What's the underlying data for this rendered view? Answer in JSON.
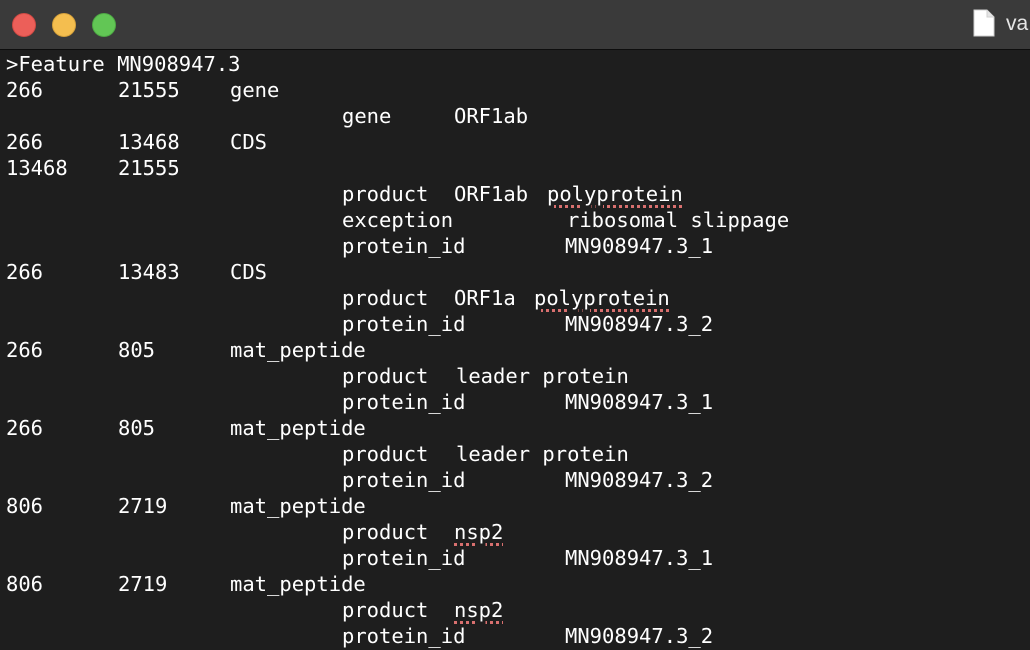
{
  "window": {
    "title": "va"
  },
  "editor": {
    "header": ">Feature MN908947.3",
    "lines": [
      {
        "c1": "266",
        "c2": "21555",
        "c3": "gene"
      },
      {
        "q": "gene",
        "v": "ORF1ab"
      },
      {
        "c1": "266",
        "c2": "13468",
        "c3": "CDS"
      },
      {
        "c1": "13468",
        "c2": "21555"
      },
      {
        "q": "product",
        "v1": "ORF1ab",
        "v2": "polyprotein"
      },
      {
        "q": "exception",
        "v": "ribosomal slippage"
      },
      {
        "q": "protein_id",
        "v": "MN908947.3_1"
      },
      {
        "c1": "266",
        "c2": "13483",
        "c3": "CDS"
      },
      {
        "q": "product",
        "v1": "ORF1a",
        "v2": "polyprotein"
      },
      {
        "q": "protein_id",
        "v": "MN908947.3_2"
      },
      {
        "c1": "266",
        "c2": "805",
        "c3": "mat_peptide"
      },
      {
        "q": "product",
        "v": "leader protein"
      },
      {
        "q": "protein_id",
        "v": "MN908947.3_1"
      },
      {
        "c1": "266",
        "c2": "805",
        "c3": "mat_peptide"
      },
      {
        "q": "product",
        "v": "leader protein"
      },
      {
        "q": "protein_id",
        "v": "MN908947.3_2"
      },
      {
        "c1": "806",
        "c2": "2719",
        "c3": "mat_peptide"
      },
      {
        "q": "product",
        "v": "nsp2"
      },
      {
        "q": "protein_id",
        "v": "MN908947.3_1"
      },
      {
        "c1": "806",
        "c2": "2719",
        "c3": "mat_peptide"
      },
      {
        "q": "product",
        "v": "nsp2"
      },
      {
        "q": "protein_id",
        "v": "MN908947.3_2"
      }
    ]
  },
  "colors": {
    "background": "#1e1e1e",
    "titlebar": "#3a3a3a",
    "text": "#ffffff",
    "spellcheck_underline": "#d9706f",
    "close": "#ec5f59",
    "minimize": "#f4be4f",
    "maximize": "#62c655"
  },
  "icons": {
    "document": "document-icon"
  }
}
